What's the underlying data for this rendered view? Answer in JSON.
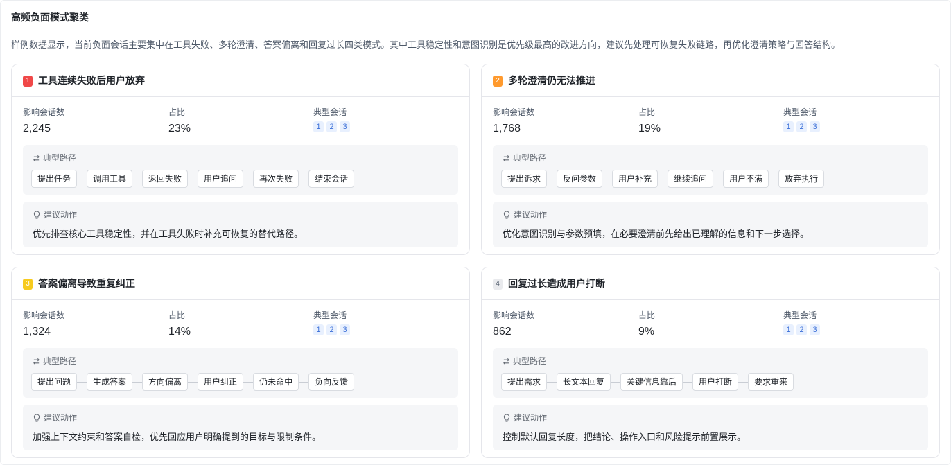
{
  "page": {
    "title": "高频负面模式聚类",
    "summary": "样例数据显示，当前负面会话主要集中在工具失败、多轮澄清、答案偏离和回复过长四类模式。其中工具稳定性和意图识别是优先级最高的改进方向，建议先处理可恢复失败链路，再优化澄清策略与回答结构。"
  },
  "labels": {
    "affected": "影响会话数",
    "ratio": "占比",
    "typical_sessions": "典型会话",
    "typical_path": "典型路径",
    "suggested_action": "建议动作"
  },
  "colors": {
    "rank_1": "#f04848",
    "rank_2": "#ff9a2e",
    "rank_3": "#f7cb1f",
    "rank_4": "#e9eaed",
    "session_chip": "#3b6fd8"
  },
  "clusters": [
    {
      "rank": "1",
      "title": "工具连续失败后用户放弃",
      "affected": "2,245",
      "ratio": "23%",
      "sessions": [
        "1",
        "2",
        "3"
      ],
      "path": [
        "提出任务",
        "调用工具",
        "返回失败",
        "用户追问",
        "再次失败",
        "结束会话"
      ],
      "action": "优先排查核心工具稳定性，并在工具失败时补充可恢复的替代路径。"
    },
    {
      "rank": "2",
      "title": "多轮澄清仍无法推进",
      "affected": "1,768",
      "ratio": "19%",
      "sessions": [
        "1",
        "2",
        "3"
      ],
      "path": [
        "提出诉求",
        "反问参数",
        "用户补充",
        "继续追问",
        "用户不满",
        "放弃执行"
      ],
      "action": "优化意图识别与参数预填，在必要澄清前先给出已理解的信息和下一步选择。"
    },
    {
      "rank": "3",
      "title": "答案偏离导致重复纠正",
      "affected": "1,324",
      "ratio": "14%",
      "sessions": [
        "1",
        "2",
        "3"
      ],
      "path": [
        "提出问题",
        "生成答案",
        "方向偏离",
        "用户纠正",
        "仍未命中",
        "负向反馈"
      ],
      "action": "加强上下文约束和答案自检，优先回应用户明确提到的目标与限制条件。"
    },
    {
      "rank": "4",
      "title": "回复过长造成用户打断",
      "affected": "862",
      "ratio": "9%",
      "sessions": [
        "1",
        "2",
        "3"
      ],
      "path": [
        "提出需求",
        "长文本回复",
        "关键信息靠后",
        "用户打断",
        "要求重来"
      ],
      "action": "控制默认回复长度，把结论、操作入口和风险提示前置展示。"
    }
  ]
}
